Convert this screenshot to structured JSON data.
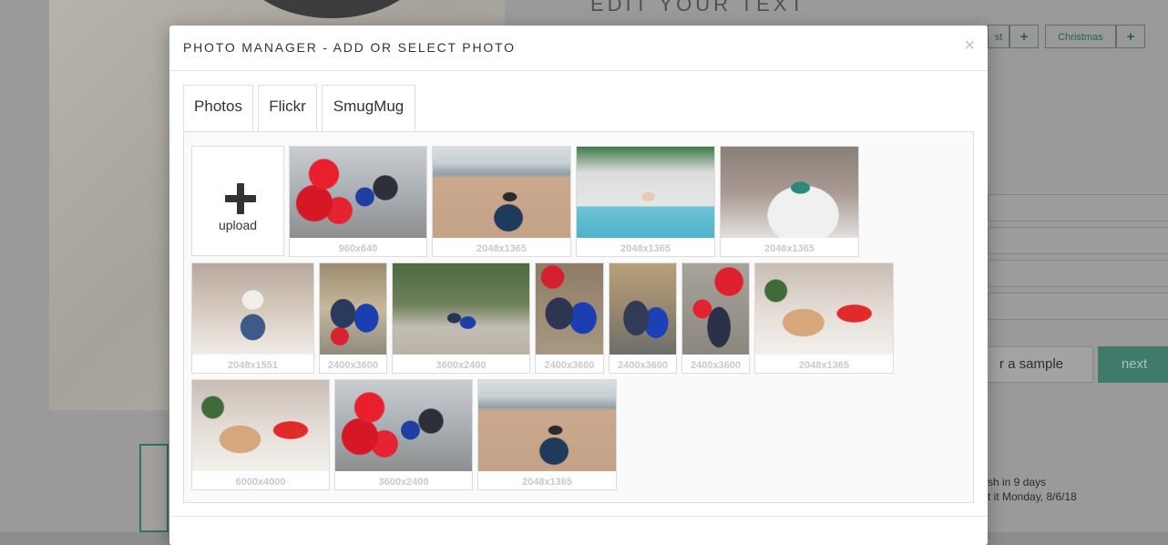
{
  "background": {
    "heading": "EDIT YOUR TEXT",
    "tags": [
      {
        "label": "st",
        "add": "+"
      },
      {
        "label": "Christmas",
        "add": "+"
      }
    ],
    "sample_button": "r a sample",
    "next_button": "next",
    "notes": [
      "sh in 9 days",
      "t it Monday, 8/6/18"
    ]
  },
  "modal": {
    "title": "PHOTO MANAGER - ADD OR SELECT PHOTO",
    "close": "×",
    "tabs": [
      {
        "label": "Photos",
        "active": true
      },
      {
        "label": "Flickr",
        "active": false
      },
      {
        "label": "SmugMug",
        "active": false
      }
    ],
    "upload_label": "upload",
    "photos": [
      {
        "dimensions": "960x640",
        "image": "red-balloons-couple"
      },
      {
        "dimensions": "2048x1365",
        "image": "beach-woman"
      },
      {
        "dimensions": "2048x1365",
        "image": "pool-woman"
      },
      {
        "dimensions": "2048x1365",
        "image": "bed-woman"
      },
      {
        "dimensions": "2048x1551",
        "image": "bed-woman-jeans"
      },
      {
        "dimensions": "2400x3600",
        "image": "couple-gifts"
      },
      {
        "dimensions": "3600x2400",
        "image": "couple-garden"
      },
      {
        "dimensions": "2400x3600",
        "image": "couple-kiss"
      },
      {
        "dimensions": "2400x3600",
        "image": "couple-kiss-street"
      },
      {
        "dimensions": "2400x3600",
        "image": "couple-balloons-kiss"
      },
      {
        "dimensions": "2048x1365",
        "image": "woman-dog-bed"
      },
      {
        "dimensions": "6000x4000",
        "image": "woman-dog-bed"
      },
      {
        "dimensions": "3600x2400",
        "image": "red-balloons-couple"
      },
      {
        "dimensions": "2048x1365",
        "image": "beach-woman"
      }
    ]
  }
}
